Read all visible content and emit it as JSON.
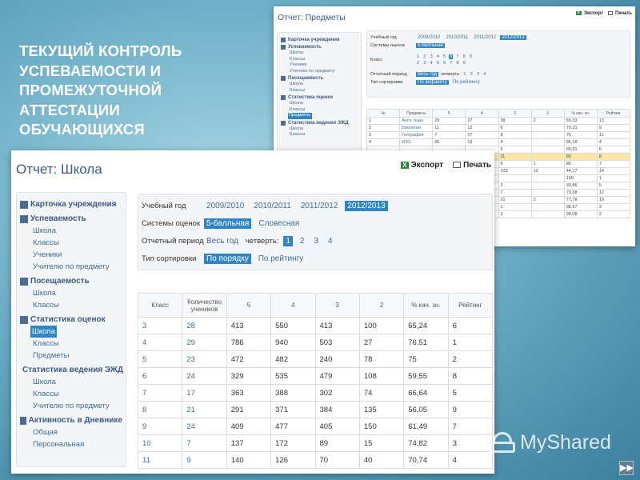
{
  "slide": {
    "title": "ТЕКУЩИЙ КОНТРОЛЬ\nУСПЕВАЕМОСТИ И\nПРОМЕЖУТОЧНОЙ\nАТТЕСТАЦИИ\nОБУЧАЮЩИХСЯ",
    "watermark": "MyShared",
    "nav_icon": "fast-forward-icon"
  },
  "front": {
    "page_title": "Отчет: Школа",
    "export_label": "Экспорт",
    "print_label": "Печать",
    "sidebar": [
      {
        "head": "Карточка учреждения",
        "items": []
      },
      {
        "head": "Успеваемость",
        "items": [
          "Школа",
          "Классы",
          "Ученики",
          "Учителю по предмету"
        ]
      },
      {
        "head": "Посещаемость",
        "items": [
          "Школа",
          "Классы"
        ]
      },
      {
        "head": "Статистика оценок",
        "items": [
          "Школа",
          "Классы",
          "Предметы"
        ],
        "selected": 0
      },
      {
        "head": "Статистика ведения ЭЖД",
        "items": [
          "Школа",
          "Классы",
          "Учителю по предмету"
        ]
      },
      {
        "head": "Активность в Дневнике",
        "items": [
          "Общая",
          "Персональная"
        ]
      }
    ],
    "filters": {
      "year_label": "Учебный год",
      "years": [
        "2009/2010",
        "2010/2011",
        "2011/2012",
        "2012/2013"
      ],
      "year_selected": "2012/2013",
      "grading_label": "Системы оценок",
      "gradings": [
        "5-балльная",
        "Словесная"
      ],
      "grading_selected": "5-балльная",
      "period_label": "Отчетный период",
      "period_all": "Весь год",
      "quarter_label": "четверть:",
      "quarters": [
        "1",
        "2",
        "3",
        "4"
      ],
      "quarter_selected": "1",
      "sort_label": "Тип сортировки",
      "sorts": [
        "По порядку",
        "По рейтингу"
      ],
      "sort_selected": "По порядку"
    },
    "table": {
      "headers": [
        "Класс",
        "Количество учеников",
        "5",
        "4",
        "3",
        "2",
        "% кач. зн.",
        "Рейтинг"
      ],
      "rows": [
        [
          "3",
          "28",
          "413",
          "550",
          "413",
          "100",
          "65,24",
          "6"
        ],
        [
          "4",
          "29",
          "786",
          "940",
          "503",
          "27",
          "76,51",
          "1"
        ],
        [
          "5",
          "23",
          "472",
          "482",
          "240",
          "78",
          "75",
          "2"
        ],
        [
          "6",
          "24",
          "329",
          "535",
          "479",
          "108",
          "59,55",
          "8"
        ],
        [
          "7",
          "17",
          "363",
          "388",
          "302",
          "74",
          "66,64",
          "5"
        ],
        [
          "8",
          "21",
          "291",
          "371",
          "384",
          "135",
          "56,05",
          "9"
        ],
        [
          "9",
          "24",
          "409",
          "477",
          "405",
          "150",
          "61,49",
          "7"
        ],
        [
          "10",
          "7",
          "137",
          "172",
          "89",
          "15",
          "74,82",
          "3"
        ],
        [
          "11",
          "9",
          "140",
          "126",
          "70",
          "40",
          "70,74",
          "4"
        ]
      ]
    }
  },
  "back": {
    "page_title": "Отчет: Предметы",
    "export_label": "Экспорт",
    "print_label": "Печать",
    "sidebar": [
      {
        "head": "Карточка учреждения",
        "items": []
      },
      {
        "head": "Успеваемость",
        "items": [
          "Школа",
          "Классы",
          "Ученики",
          "Учителю по предмету"
        ]
      },
      {
        "head": "Посещаемость",
        "items": [
          "Школа",
          "Классы"
        ]
      },
      {
        "head": "Статистика оценок",
        "items": [
          "Школа",
          "Классы",
          "Предметы"
        ],
        "selected": 2
      },
      {
        "head": "Статистика ведения ЭЖД",
        "items": [
          "Школа",
          "Классы"
        ]
      }
    ],
    "filters": {
      "year_label": "Учебный год",
      "years": [
        "2009/2010",
        "2010/2011",
        "2011/2012",
        "2012/2013"
      ],
      "year_selected": "2012/2013",
      "grading_label": "Системы оценок",
      "gradings": [
        "5-балльная"
      ],
      "grading_selected": "5-балльная",
      "class_label": "Класс",
      "class_rows": [
        [
          "1",
          "2",
          "3",
          "4",
          "5",
          "6",
          "7",
          "8",
          "9"
        ],
        [
          "2",
          "3",
          "4",
          "5",
          "6",
          "7",
          "8",
          "9"
        ]
      ],
      "class_selected": "6",
      "period_label": "Отчетный период",
      "period_all": "Весь год",
      "quarter_label": "четверть:",
      "quarters": [
        "1",
        "2",
        "3",
        "4"
      ],
      "sort_label": "Тип сортировки",
      "sorts": [
        "По алфавиту",
        "По рейтингу"
      ],
      "sort_selected": "По алфавиту"
    },
    "table": {
      "headers": [
        "№",
        "Предметы",
        "5",
        "4",
        "3",
        "2",
        "% кач. зн.",
        "Рейтинг"
      ],
      "rows": [
        [
          "1",
          "Англ. язык",
          "29",
          "27",
          "38",
          "2",
          "59,33",
          "13"
        ],
        [
          "2",
          "Биология",
          "11",
          "12",
          "6",
          "",
          "79,31",
          "9"
        ],
        [
          "3",
          "География",
          "7",
          "17",
          "8",
          "",
          "75",
          "11"
        ],
        [
          "4",
          "ИЗО",
          "66",
          "13",
          "4",
          "",
          "95,18",
          "4"
        ],
        [
          "",
          "",
          "",
          "",
          "5",
          "",
          "90,91",
          "6"
        ],
        [
          "",
          "",
          "",
          "",
          "11",
          "",
          "80",
          "8"
        ],
        [
          "",
          "",
          "",
          "",
          "6",
          "1",
          "86",
          "7"
        ],
        [
          "",
          "",
          "",
          "",
          "103",
          "12",
          "44,17",
          "14"
        ],
        [
          "",
          "",
          "",
          "",
          "",
          "",
          "100",
          "1"
        ],
        [
          "",
          "",
          "",
          "",
          "2",
          "",
          "92,86",
          "5"
        ],
        [
          "",
          "",
          "",
          "",
          "7",
          "",
          "73,08",
          "12"
        ],
        [
          "",
          "",
          "",
          "",
          "31",
          "2",
          "77,78",
          "10"
        ],
        [
          "",
          "",
          "",
          "",
          "1",
          "",
          "96,97",
          "3"
        ],
        [
          "",
          "",
          "",
          "",
          "1",
          "",
          "99,08",
          "2"
        ]
      ],
      "highlight_row": 5
    }
  }
}
